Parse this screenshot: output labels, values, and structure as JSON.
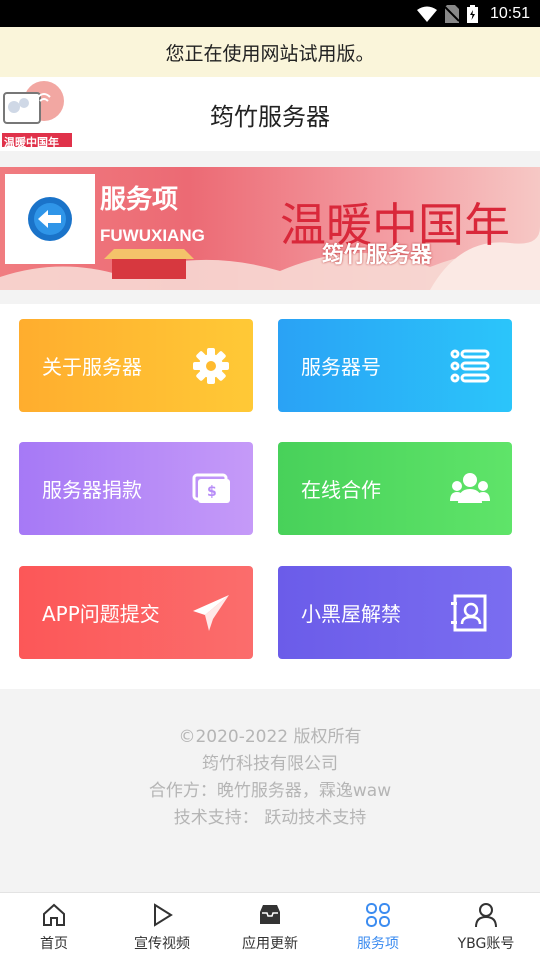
{
  "status_bar": {
    "time": "10:51"
  },
  "trial_banner": {
    "text": "您正在使用网站试用版。"
  },
  "header": {
    "title": "筠竹服务器",
    "logo_text": "温暖中国年"
  },
  "banner": {
    "title": "服务项",
    "subtitle": "FUWUXIANG",
    "big_text": "温暖中国年",
    "sub_text": "筠竹服务器"
  },
  "tiles": [
    {
      "label": "关于服务器",
      "icon": "gear-icon",
      "color": "#ffb52e"
    },
    {
      "label": "服务器号",
      "icon": "list-icon",
      "color": "#2ab3f7"
    },
    {
      "label": "服务器捐款",
      "icon": "money-icon",
      "color": "#b589f7"
    },
    {
      "label": "在线合作",
      "icon": "team-icon",
      "color": "#50d95e"
    },
    {
      "label": "APP问题提交",
      "icon": "paper-plane-icon",
      "color": "#fb5f61"
    },
    {
      "label": "小黑屋解禁",
      "icon": "contact-card-icon",
      "color": "#6969ec"
    }
  ],
  "footer": {
    "copyright": "©2020-2022 版权所有",
    "company": "筠竹科技有限公司",
    "partners": "合作方：晚竹服务器，霖逸waw",
    "support": "技术支持：  跃动技术支持"
  },
  "tabbar": {
    "items": [
      {
        "label": "首页",
        "icon": "home-icon"
      },
      {
        "label": "宣传视频",
        "icon": "play-icon"
      },
      {
        "label": "应用更新",
        "icon": "inbox-icon"
      },
      {
        "label": "服务项",
        "icon": "grid-icon",
        "active": true
      },
      {
        "label": "YBG账号",
        "icon": "user-icon"
      }
    ]
  }
}
